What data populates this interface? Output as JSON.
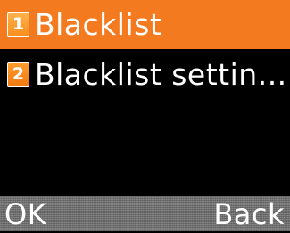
{
  "menu": {
    "items": [
      {
        "number": "1",
        "label": "Blacklist",
        "selected": true
      },
      {
        "number": "2",
        "label": "Blacklist settin...",
        "selected": false
      }
    ]
  },
  "softkeys": {
    "left": "OK",
    "right": "Back"
  },
  "colors": {
    "highlight": "#f47a1f",
    "background": "#000000",
    "softkey_bar": "#777777"
  }
}
